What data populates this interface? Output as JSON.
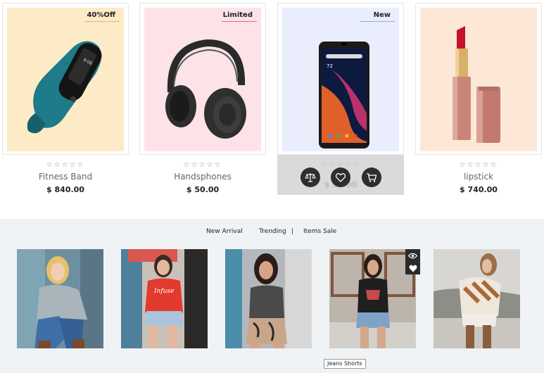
{
  "colors": {
    "fitness_bg": "#fdeac7",
    "headphones_bg": "#fde3e7",
    "phone_bg": "#eaeefc",
    "lipstick_bg": "#fde8d8",
    "badge_orange": "#f0b36b",
    "badge_pink": "#e26b8a",
    "badge_blue": "#9aa9e3",
    "section_bg": "#eff3f6"
  },
  "products": [
    {
      "badge": "40%Off",
      "stars": "☆☆☆☆☆",
      "name": "Fitness Band",
      "price": "$ 840.00",
      "icon": "fitness-band-image"
    },
    {
      "badge": "Limited",
      "stars": "☆☆☆☆☆",
      "name": "Handsphones",
      "price": "$ 50.00",
      "icon": "headphones-image"
    },
    {
      "badge": "New",
      "stars": "☆☆☆☆☆",
      "name": "",
      "price": "$ 50.00",
      "icon": "smartphone-image"
    },
    {
      "badge": "",
      "stars": "☆☆☆☆☆",
      "name": "lipstick",
      "price": "$ 740.00",
      "icon": "lipstick-image"
    }
  ],
  "actions": [
    "compare-icon",
    "wishlist-heart-icon",
    "cart-icon"
  ],
  "tabs": {
    "new_arrival": "New Arrival",
    "trending": "Trending",
    "separator": "|",
    "items_sale": "Items Sale"
  },
  "arrivals": [
    {
      "photo": "woman-grey-sweater-photo"
    },
    {
      "photo": "woman-red-shirt-photo"
    },
    {
      "photo": "woman-grey-tank-photo"
    },
    {
      "photo": "woman-jeans-shorts-photo"
    },
    {
      "photo": "woman-striped-sweater-photo"
    }
  ],
  "tooltip": "Jeans Shorts"
}
